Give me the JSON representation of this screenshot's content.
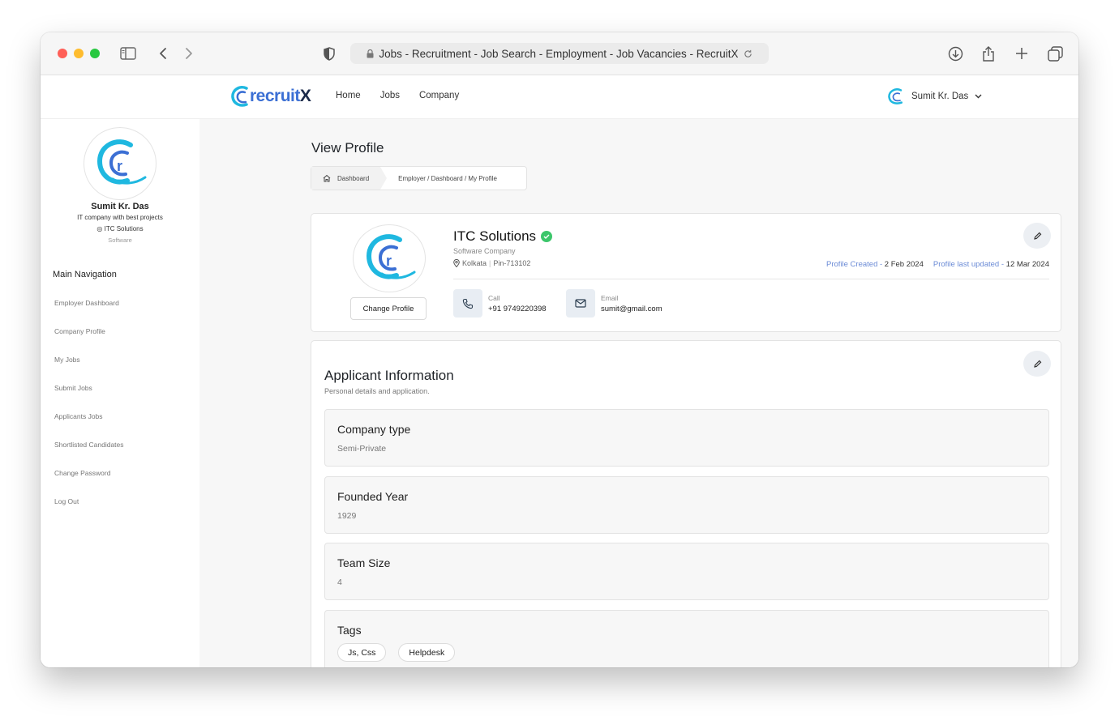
{
  "browser": {
    "url_title": "Jobs - Recruitment - Job Search -  Employment - Job Vacancies - RecruitX"
  },
  "navbar": {
    "logo_main": "recruit",
    "logo_x": "X",
    "links": [
      "Home",
      "Jobs",
      "Company"
    ],
    "user_name": "Sumit Kr. Das"
  },
  "sidebar": {
    "name": "Sumit Kr. Das",
    "tagline": "IT company with best projects",
    "company": "ITC Solutions",
    "category": "Software",
    "heading": "Main Navigation",
    "items": [
      "Employer Dashboard",
      "Company Profile",
      "My Jobs",
      "Submit Jobs",
      "Applicants Jobs",
      "Shortlisted Candidates",
      "Change Password",
      "Log Out"
    ]
  },
  "main": {
    "title": "View Profile",
    "breadcrumb": {
      "home": "Dashboard",
      "path": "Employer / Dashboard / My Profile"
    },
    "profile": {
      "change_label": "Change Profile",
      "company_name": "ITC Solutions",
      "company_type": "Software Company",
      "city": "Kolkata",
      "pin": "Pin-713102",
      "created_label": "Profile Created - ",
      "created_value": "2 Feb 2024",
      "updated_label": "Profile last updated - ",
      "updated_value": "12 Mar 2024",
      "call_label": "Call",
      "call_value": "+91 9749220398",
      "email_label": "Email",
      "email_value": "sumit@gmail.com"
    },
    "applicant": {
      "title": "Applicant Information",
      "subtitle": "Personal details and application.",
      "fields": [
        {
          "label": "Company type",
          "value": "Semi-Private"
        },
        {
          "label": "Founded Year",
          "value": "1929"
        },
        {
          "label": "Team Size",
          "value": "4"
        }
      ],
      "tags_label": "Tags",
      "tags": [
        "Js, Css",
        "Helpdesk"
      ]
    }
  },
  "colors": {
    "accent_blue": "#3b6fd4",
    "logo_cyan": "#1fb8e0",
    "verified_green": "#3cc66b"
  }
}
